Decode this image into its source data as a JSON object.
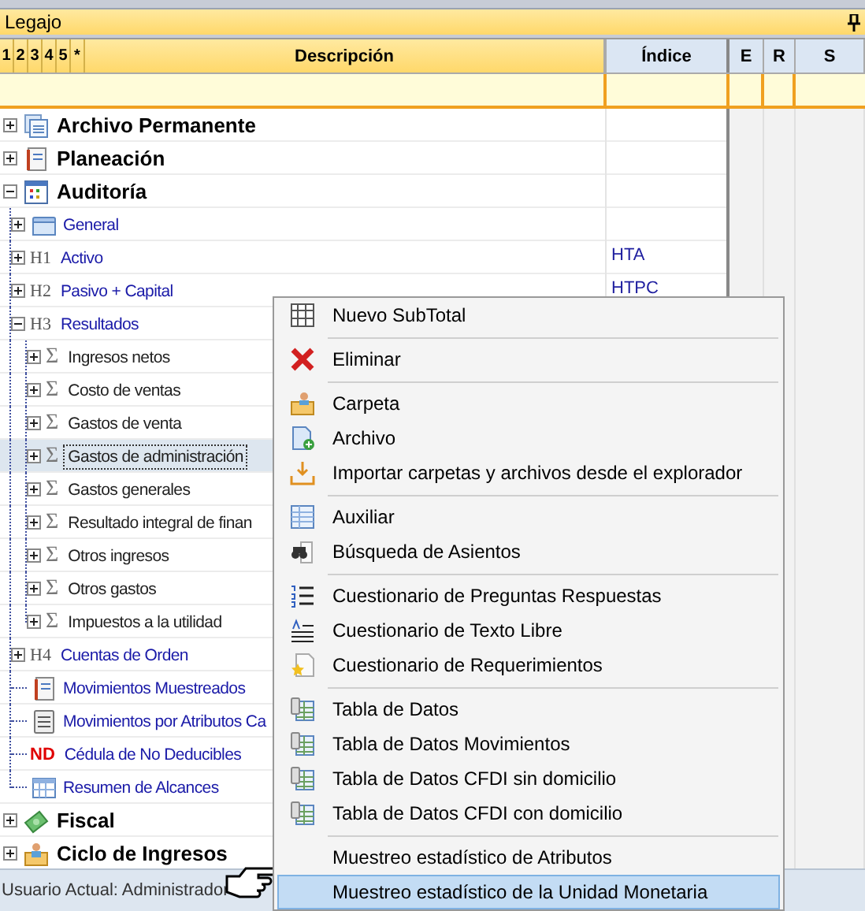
{
  "panel": {
    "title": "Legajo"
  },
  "columns": {
    "levels": [
      "1",
      "2",
      "3",
      "4",
      "5",
      "*"
    ],
    "description": "Descripción",
    "index": "Índice",
    "column_e": "E",
    "column_r": "R",
    "column_s": "S"
  },
  "tree": [
    {
      "label": "Archivo Permanente",
      "kind": "archive",
      "expanded": false,
      "selected": false
    },
    {
      "label": "Planeación",
      "kind": "notebook",
      "expanded": false,
      "selected": false
    },
    {
      "label": "Auditoría",
      "kind": "grid",
      "expanded": true,
      "selected": false,
      "children": [
        {
          "label": "General",
          "kind": "folder",
          "expanded": false,
          "selected": false
        },
        {
          "label": "Activo",
          "marker": "H1",
          "kind": "heading",
          "index": "HTA",
          "expanded": false,
          "selected": false
        },
        {
          "label": "Pasivo + Capital",
          "marker": "H2",
          "kind": "heading",
          "index": "HTPC",
          "expanded": false,
          "selected": false
        },
        {
          "label": "Resultados",
          "marker": "H3",
          "kind": "heading",
          "expanded": true,
          "selected": false,
          "children": [
            {
              "label": "Ingresos netos",
              "marker": "Σ",
              "kind": "sum",
              "expanded": false,
              "selected": false
            },
            {
              "label": "Costo de ventas",
              "marker": "Σ",
              "kind": "sum",
              "expanded": false,
              "selected": false
            },
            {
              "label": "Gastos de venta",
              "marker": "Σ",
              "kind": "sum",
              "expanded": false,
              "selected": false
            },
            {
              "label": "Gastos de administración",
              "marker": "Σ",
              "kind": "sum",
              "expanded": false,
              "selected": true
            },
            {
              "label": "Gastos generales",
              "marker": "Σ",
              "kind": "sum",
              "expanded": false,
              "selected": false
            },
            {
              "label": "Resultado integral de finan",
              "marker": "Σ",
              "kind": "sum",
              "expanded": false,
              "selected": false
            },
            {
              "label": "Otros ingresos",
              "marker": "Σ",
              "kind": "sum",
              "expanded": false,
              "selected": false
            },
            {
              "label": "Otros gastos",
              "marker": "Σ",
              "kind": "sum",
              "expanded": false,
              "selected": false
            },
            {
              "label": "Impuestos a la utilidad",
              "marker": "Σ",
              "kind": "sum",
              "expanded": false,
              "selected": false
            }
          ]
        },
        {
          "label": "Cuentas de Orden",
          "marker": "H4",
          "kind": "heading",
          "expanded": false,
          "selected": false
        },
        {
          "label": "Movimientos Muestreados",
          "kind": "notebook",
          "selected": false
        },
        {
          "label": "Movimientos por Atributos Ca",
          "kind": "list",
          "selected": false
        },
        {
          "label": "Cédula de No Deducibles",
          "marker": "ND",
          "kind": "nd",
          "selected": false
        },
        {
          "label": "Resumen de Alcances",
          "kind": "calendar",
          "selected": false
        }
      ]
    },
    {
      "label": "Fiscal",
      "kind": "money",
      "expanded": false,
      "selected": false
    },
    {
      "label": "Ciclo de Ingresos",
      "kind": "person-folder",
      "expanded": false,
      "selected": false
    }
  ],
  "status_bar": {
    "user": "Usuario Actual: Administrador"
  },
  "context_menu": [
    [
      {
        "label": "Nuevo SubTotal",
        "kind": "subtotal",
        "selected": false
      }
    ],
    [
      {
        "label": "Eliminar",
        "kind": "delete",
        "selected": false
      }
    ],
    [
      {
        "label": "Carpeta",
        "kind": "folder",
        "selected": false
      },
      {
        "label": "Archivo",
        "kind": "file",
        "selected": false
      },
      {
        "label": "Importar carpetas y archivos desde el explorador",
        "kind": "import",
        "selected": false
      }
    ],
    [
      {
        "label": "Auxiliar",
        "kind": "table",
        "selected": false
      },
      {
        "label": "Búsqueda de Asientos",
        "kind": "search",
        "selected": false
      }
    ],
    [
      {
        "label": "Cuestionario de Preguntas Respuestas",
        "kind": "numbered",
        "selected": false
      },
      {
        "label": "Cuestionario de Texto Libre",
        "kind": "text",
        "selected": false
      },
      {
        "label": "Cuestionario de Requerimientos",
        "kind": "star",
        "selected": false
      }
    ],
    [
      {
        "label": "Tabla de Datos",
        "kind": "datatable",
        "selected": false
      },
      {
        "label": "Tabla de Datos Movimientos",
        "kind": "datatable",
        "selected": false
      },
      {
        "label": "Tabla de Datos CFDI sin domicilio",
        "kind": "datatable",
        "selected": false
      },
      {
        "label": "Tabla de Datos CFDI con domicilio",
        "kind": "datatable",
        "selected": false
      }
    ],
    [
      {
        "label": "Muestreo estadístico de Atributos",
        "kind": "plain",
        "selected": false
      },
      {
        "label": "Muestreo estadístico de la Unidad Monetaria",
        "kind": "plain",
        "selected": true
      }
    ]
  ]
}
